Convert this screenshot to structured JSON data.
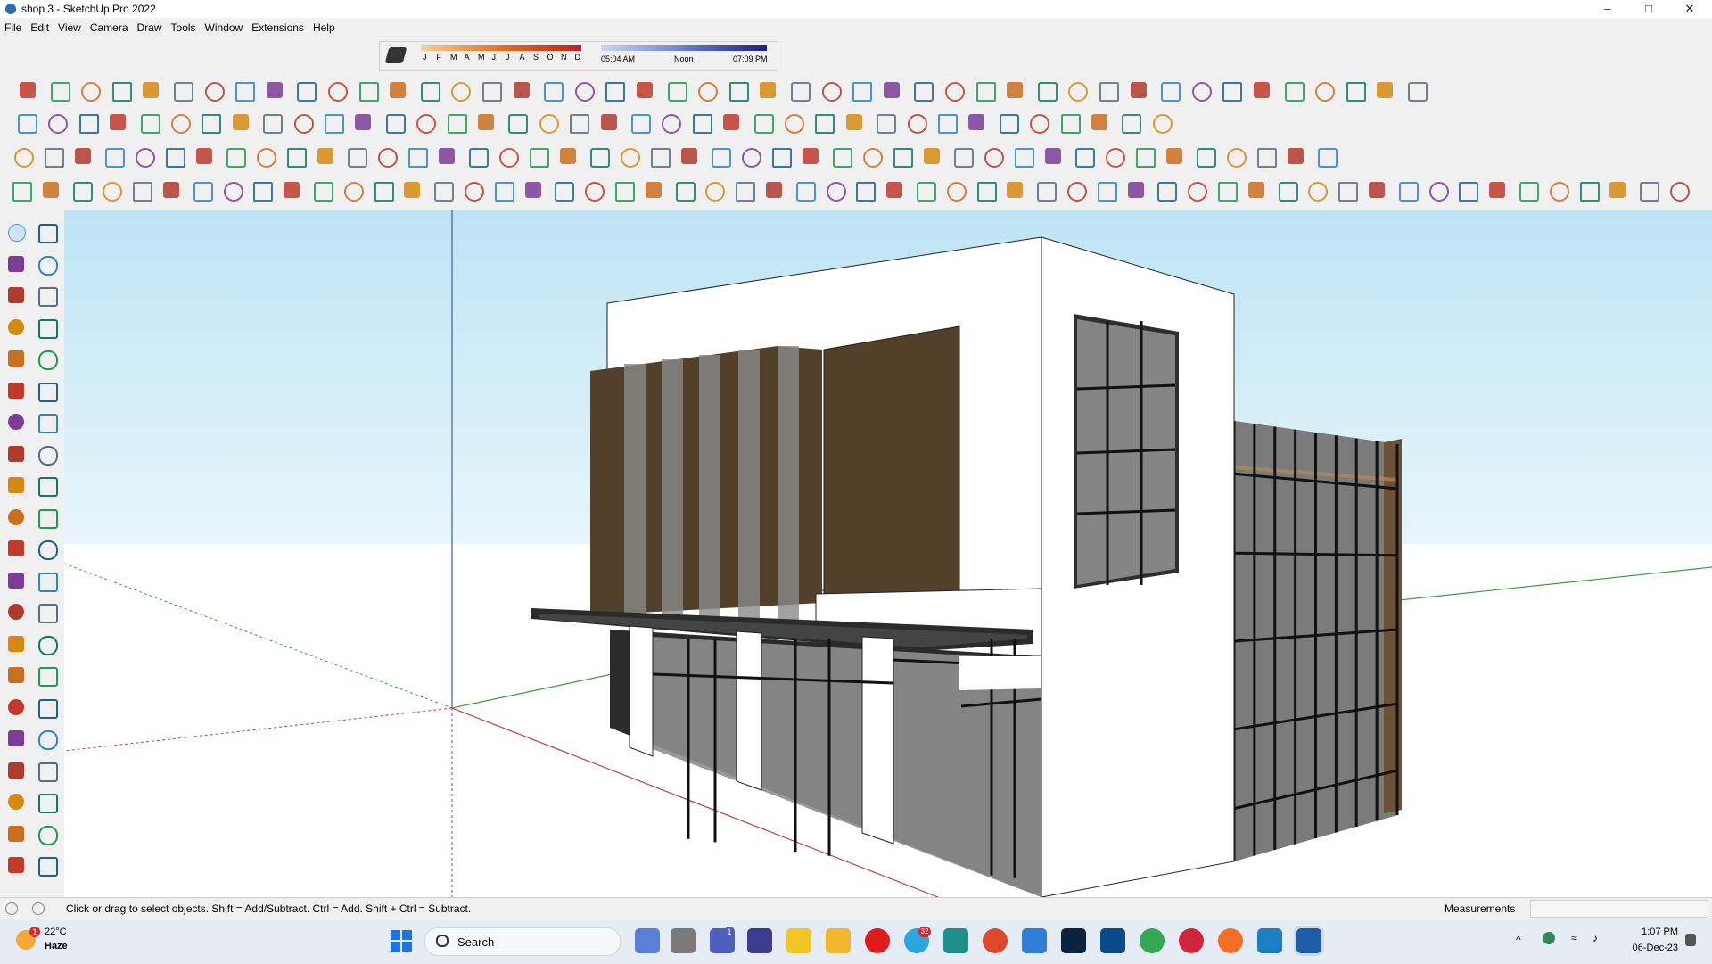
{
  "window": {
    "title": "shop 3 - SketchUp Pro 2022",
    "controls": [
      "–",
      "□",
      "✕"
    ]
  },
  "menu": [
    "File",
    "Edit",
    "View",
    "Camera",
    "Draw",
    "Tools",
    "Window",
    "Extensions",
    "Help"
  ],
  "shadow_settings": {
    "months": [
      "J",
      "F",
      "M",
      "A",
      "M",
      "J",
      "J",
      "A",
      "S",
      "O",
      "N",
      "D"
    ],
    "time_start": "05:04 AM",
    "time_mid": "Noon",
    "time_end": "07:09 PM"
  },
  "toolbar_rows": [
    {
      "count": 46,
      "icon": "extension-tool-icon"
    },
    {
      "count": 38,
      "icon": "modeling-tool-icon"
    },
    {
      "count": 44,
      "icon": "utility-tool-icon"
    },
    {
      "count": 56,
      "icon": "solid-tool-icon"
    }
  ],
  "left_tools": [
    "select-icon",
    "orbit-icon",
    "paint-bucket-icon",
    "eraser-icon",
    "component-icon",
    "tag-icon",
    "pencil-icon",
    "freehand-icon",
    "rectangle-icon",
    "rotated-rectangle-icon",
    "circle-icon",
    "polygon-icon",
    "arc-icon",
    "two-point-arc-icon",
    "pie-icon",
    "three-point-arc-icon",
    "move-icon",
    "push-pull-icon",
    "rotate-icon",
    "follow-me-icon",
    "scale-icon",
    "offset-icon",
    "tape-measure-icon",
    "dimension-icon",
    "protractor-icon",
    "text-icon",
    "axes-icon",
    "3d-text-icon",
    "orbit-view-icon",
    "pan-icon",
    "zoom-icon",
    "zoom-window-icon",
    "zoom-extents-icon",
    "previous-view-icon",
    "position-camera-icon",
    "look-around-icon",
    "walk-icon",
    "section-plane-icon",
    "warehouse-icon",
    "extension-warehouse-icon",
    "layout-icon",
    "send-to-layout-icon"
  ],
  "status": {
    "hint": "Click or drag to select objects. Shift = Add/Subtract. Ctrl = Add. Shift + Ctrl = Subtract.",
    "measurements_label": "Measurements",
    "measurements_value": ""
  },
  "taskbar": {
    "weather_temp": "22°C",
    "weather_desc": "Haze",
    "weather_badge": "1",
    "search_label": "Search",
    "teams_badge": "1",
    "telegram_badge": "32",
    "time": "1:07 PM",
    "date": "06-Dec-23",
    "apps": [
      "windows-start-icon",
      "search-box",
      "task-view-icon",
      "files-icon",
      "teams-icon",
      "calculator-icon",
      "sticky-notes-icon",
      "file-explorer-icon",
      "opera-icon",
      "telegram-icon",
      "app-icon",
      "grammarly-icon",
      "visual-studio-icon",
      "photoshop-icon",
      "autodesk-icon",
      "chrome-icon",
      "pinterest-icon",
      "soundcloud-icon",
      "sketchup-pin-icon",
      "sketchup-active-icon"
    ]
  },
  "colors": {
    "sky_top": "#bde4f4",
    "sky_bottom": "#e8f5fb",
    "ground": "#ffffff",
    "wall_white": "#ffffff",
    "wood": "#53402b",
    "glass": "#8b8b8b",
    "frame": "#1a1a1a",
    "axis_red": "#c04040",
    "axis_green": "#3a9a3a",
    "axis_blue": "#3d5fa8"
  }
}
